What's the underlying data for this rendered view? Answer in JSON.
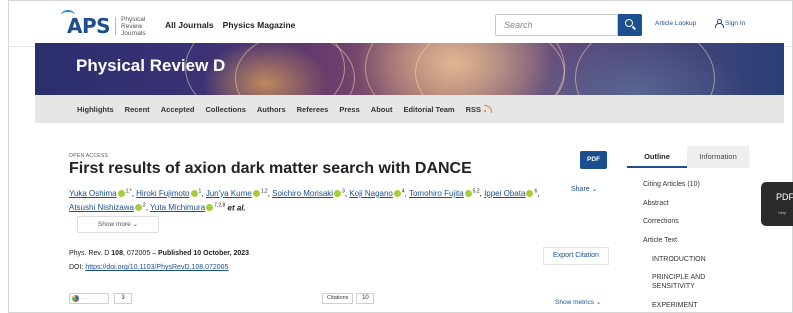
{
  "header": {
    "logo_text": "APS",
    "logo_sub": "Physical Review Journals",
    "nav": [
      "All Journals",
      "Physics Magazine"
    ],
    "search_placeholder": "Search",
    "article_lookup": "Article Lookup",
    "sign_in": "Sign In"
  },
  "banner": {
    "title": "Physical Review D"
  },
  "subnav": [
    "Highlights",
    "Recent",
    "Accepted",
    "Collections",
    "Authors",
    "Referees",
    "Press",
    "About",
    "Editorial Team",
    "RSS"
  ],
  "article": {
    "badge": "OPEN ACCESS",
    "title": "First results of axion dark matter search with DANCE",
    "pdf_label": "PDF",
    "share_label": "Share",
    "authors": [
      {
        "name": "Yuka Oshima",
        "sup": "1,*"
      },
      {
        "name": "Hiroki Fujimoto",
        "sup": "1"
      },
      {
        "name": "Jun'ya Kume",
        "sup": "1,2"
      },
      {
        "name": "Soichiro Morisaki",
        "sup": "3"
      },
      {
        "name": "Koji Nagano",
        "sup": "4"
      },
      {
        "name": "Tomohiro Fujita",
        "sup": "5,2"
      },
      {
        "name": "Ippei Obata",
        "sup": "6"
      },
      {
        "name": "Atsushi Nishizawa",
        "sup": "2"
      },
      {
        "name": "Yuta Michimura",
        "sup": "7,2,8"
      }
    ],
    "et_al": "et al.",
    "show_more": "Show more",
    "journal_prefix": "Phys. Rev. D ",
    "volume": "108",
    "pages": ", 072005 – ",
    "published": "Published 10 October, 2023",
    "doi_label": "DOI: ",
    "doi": "https://doi.org/10.1103/PhysRevD.108.072005",
    "export": "Export Citation",
    "altmetric_count": "3",
    "citations_label": "Citations",
    "citations_count": "10",
    "show_metrics": "Show metrics"
  },
  "sidebar": {
    "tabs": [
      "Outline",
      "Information"
    ],
    "items": [
      "Citing Articles (10)",
      "Abstract",
      "Corrections",
      "Article Text"
    ],
    "subitems": [
      "INTRODUCTION",
      "PRINCIPLE AND SENSITIVITY",
      "EXPERIMENT"
    ]
  },
  "floating": {
    "pdf": "PDF",
    "help": "Help"
  },
  "colors": {
    "brand": "#1c4f8f",
    "orcid": "#a6ce39",
    "rss": "#e08a2a"
  }
}
